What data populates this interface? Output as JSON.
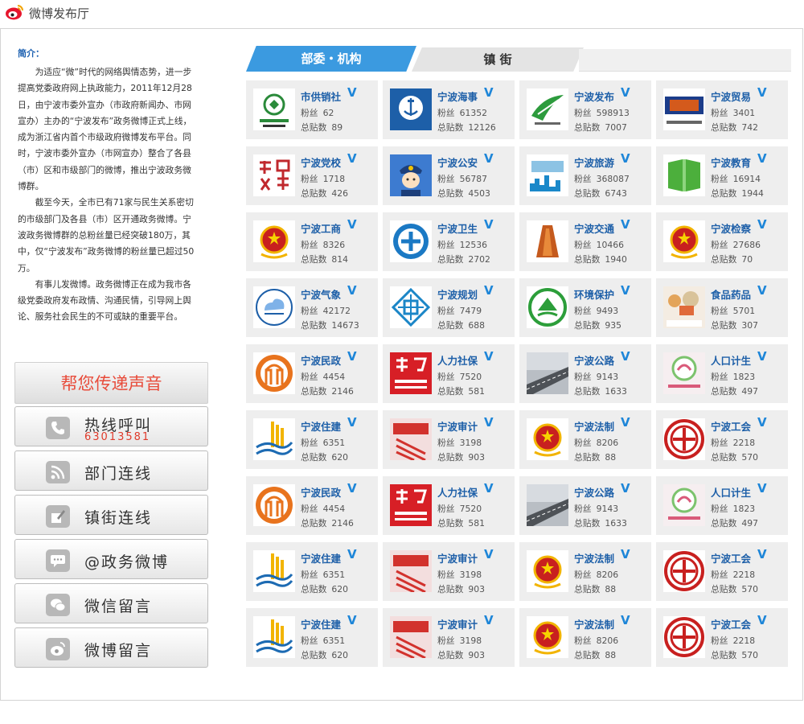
{
  "page_title": "微博发布厅",
  "intro_heading": "简介：",
  "intro_paragraphs": [
    "为适应“微”时代的网络舆情态势，进一步提高党委政府网上执政能力，2011年12月28日，由宁波市委外宣办（市政府新闻办、市网宣办）主办的“宁波发布”政务微博正式上线，成为浙江省内首个市级政府微博发布平台。同时，宁波市委外宣办（市网宣办）整合了各县（市）区和市级部门的微博，推出宁波政务微博群。",
    "截至今天，全市已有71家与民生关系密切的市级部门及各县（市）区开通政务微博。宁波政务微博群的总粉丝量已经突破180万，其中，仅“宁波发布”政务微博的粉丝量已超过50万。",
    "有事儿发微博。政务微博正在成为我市各级党委政府发布政情、沟通民情，引导网上舆论、服务社会民生的不可或缺的重要平台。"
  ],
  "help": {
    "title": "帮您传递声音",
    "buttons": [
      {
        "label": "热线呼叫",
        "sub": "63013581",
        "icon": "phone-icon"
      },
      {
        "label": "部门连线",
        "sub": "",
        "icon": "rss-icon"
      },
      {
        "label": "镇街连线",
        "sub": "",
        "icon": "pen-icon"
      },
      {
        "label": "@政务微博",
        "sub": "",
        "icon": "chat-icon"
      },
      {
        "label": "微信留言",
        "sub": "",
        "icon": "wechat-icon"
      },
      {
        "label": "微博留言",
        "sub": "",
        "icon": "weibo-icon"
      }
    ]
  },
  "tabs": [
    "部委・机构",
    "镇 街"
  ],
  "labels": {
    "fans": "粉丝",
    "posts": "总贴数",
    "verified": "V"
  },
  "accounts": [
    {
      "name": "市供销社",
      "fans": "62",
      "posts": "89",
      "avatar": "coop-logo",
      "color": "#2a8a3a"
    },
    {
      "name": "宁波海事",
      "fans": "61352",
      "posts": "12126",
      "avatar": "maritime-logo",
      "color": "#1d5fa8"
    },
    {
      "name": "宁波发布",
      "fans": "598913",
      "posts": "7007",
      "avatar": "ningbo-release-logo",
      "color": "#2d9b3d"
    },
    {
      "name": "宁波贸易",
      "fans": "3401",
      "posts": "742",
      "avatar": "trade-logo",
      "color": "#d45a1c"
    },
    {
      "name": "宁波党校",
      "fans": "1718",
      "posts": "426",
      "avatar": "party-school-logo",
      "color": "#c0282d"
    },
    {
      "name": "宁波公安",
      "fans": "56787",
      "posts": "4503",
      "avatar": "police-logo",
      "color": "#2a63b5"
    },
    {
      "name": "宁波旅游",
      "fans": "368087",
      "posts": "6743",
      "avatar": "tourism-logo",
      "color": "#1a88c9"
    },
    {
      "name": "宁波教育",
      "fans": "16914",
      "posts": "1944",
      "avatar": "education-logo",
      "color": "#4caf3c"
    },
    {
      "name": "宁波工商",
      "fans": "8326",
      "posts": "814",
      "avatar": "commerce-emblem",
      "color": "#c8201f"
    },
    {
      "name": "宁波卫生",
      "fans": "12536",
      "posts": "2702",
      "avatar": "health-logo",
      "color": "#1b79c4"
    },
    {
      "name": "宁波交通",
      "fans": "10466",
      "posts": "1940",
      "avatar": "transport-logo",
      "color": "#c55a1d"
    },
    {
      "name": "宁波检察",
      "fans": "27686",
      "posts": "70",
      "avatar": "procuratorate-emblem",
      "color": "#c8201f"
    },
    {
      "name": "宁波气象",
      "fans": "42172",
      "posts": "14673",
      "avatar": "weather-logo",
      "color": "#1d5fa8"
    },
    {
      "name": "宁波规划",
      "fans": "7479",
      "posts": "688",
      "avatar": "planning-logo",
      "color": "#1b86c7"
    },
    {
      "name": "环境保护",
      "fans": "9493",
      "posts": "935",
      "avatar": "environment-logo",
      "color": "#2c9e3a"
    },
    {
      "name": "食品药品",
      "fans": "5701",
      "posts": "307",
      "avatar": "nbfda-logo",
      "color": "#c98a3a"
    },
    {
      "name": "宁波民政",
      "fans": "4454",
      "posts": "2146",
      "avatar": "civil-affairs-logo",
      "color": "#e8731d"
    },
    {
      "name": "人力社保",
      "fans": "7520",
      "posts": "581",
      "avatar": "hr-social-logo",
      "color": "#d71f26"
    },
    {
      "name": "宁波公路",
      "fans": "9143",
      "posts": "1633",
      "avatar": "highway-photo",
      "color": "#7a7f86"
    },
    {
      "name": "人口计生",
      "fans": "1823",
      "posts": "497",
      "avatar": "population-logo",
      "color": "#d95a7a"
    },
    {
      "name": "宁波住建",
      "fans": "6351",
      "posts": "620",
      "avatar": "housing-logo",
      "color": "#1d6bb3"
    },
    {
      "name": "宁波审计",
      "fans": "3198",
      "posts": "903",
      "avatar": "audit-logo",
      "color": "#d2322d"
    },
    {
      "name": "宁波法制",
      "fans": "8206",
      "posts": "88",
      "avatar": "legal-emblem",
      "color": "#c8201f"
    },
    {
      "name": "宁波工会",
      "fans": "2218",
      "posts": "570",
      "avatar": "union-logo",
      "color": "#c8201f"
    },
    {
      "name": "宁波民政",
      "fans": "4454",
      "posts": "2146",
      "avatar": "civil-affairs-logo",
      "color": "#e8731d"
    },
    {
      "name": "人力社保",
      "fans": "7520",
      "posts": "581",
      "avatar": "hr-social-logo",
      "color": "#d71f26"
    },
    {
      "name": "宁波公路",
      "fans": "9143",
      "posts": "1633",
      "avatar": "highway-photo",
      "color": "#7a7f86"
    },
    {
      "name": "人口计生",
      "fans": "1823",
      "posts": "497",
      "avatar": "population-logo",
      "color": "#d95a7a"
    },
    {
      "name": "宁波住建",
      "fans": "6351",
      "posts": "620",
      "avatar": "housing-logo",
      "color": "#1d6bb3"
    },
    {
      "name": "宁波审计",
      "fans": "3198",
      "posts": "903",
      "avatar": "audit-logo",
      "color": "#d2322d"
    },
    {
      "name": "宁波法制",
      "fans": "8206",
      "posts": "88",
      "avatar": "legal-emblem",
      "color": "#c8201f"
    },
    {
      "name": "宁波工会",
      "fans": "2218",
      "posts": "570",
      "avatar": "union-logo",
      "color": "#c8201f"
    },
    {
      "name": "宁波住建",
      "fans": "6351",
      "posts": "620",
      "avatar": "housing-logo",
      "color": "#1d6bb3"
    },
    {
      "name": "宁波审计",
      "fans": "3198",
      "posts": "903",
      "avatar": "audit-logo",
      "color": "#d2322d"
    },
    {
      "name": "宁波法制",
      "fans": "8206",
      "posts": "88",
      "avatar": "legal-emblem",
      "color": "#c8201f"
    },
    {
      "name": "宁波工会",
      "fans": "2218",
      "posts": "570",
      "avatar": "union-logo",
      "color": "#c8201f"
    }
  ]
}
